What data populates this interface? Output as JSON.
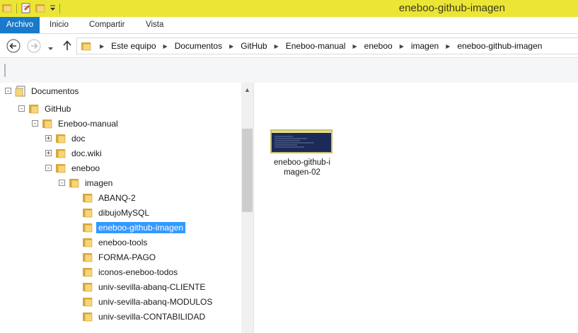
{
  "window": {
    "title": "eneboo-github-imagen"
  },
  "ribbon": {
    "tabs": [
      "Archivo",
      "Inicio",
      "Compartir",
      "Vista"
    ]
  },
  "address": {
    "crumbs": [
      "Este equipo",
      "Documentos",
      "GitHub",
      "Eneboo-manual",
      "eneboo",
      "imagen",
      "eneboo-github-imagen"
    ]
  },
  "tree": [
    {
      "label": "Documentos",
      "expander": "−",
      "icon": "documents-library-icon"
    },
    {
      "label": "GitHub",
      "expander": "−",
      "icon": "folder-icon"
    },
    {
      "label": "Eneboo-manual",
      "expander": "−",
      "icon": "folder-icon"
    },
    {
      "label": "doc",
      "expander": "+",
      "icon": "folder-icon"
    },
    {
      "label": "doc.wiki",
      "expander": "+",
      "icon": "folder-icon"
    },
    {
      "label": "eneboo",
      "expander": "−",
      "icon": "folder-icon"
    },
    {
      "label": "imagen",
      "expander": "−",
      "icon": "folder-icon"
    },
    {
      "label": "ABANQ-2",
      "expander": "",
      "icon": "folder-icon"
    },
    {
      "label": "dibujoMySQL",
      "expander": "",
      "icon": "folder-icon"
    },
    {
      "label": "eneboo-github-imagen",
      "expander": "",
      "icon": "folder-icon",
      "selected": true
    },
    {
      "label": "eneboo-tools",
      "expander": "",
      "icon": "folder-icon"
    },
    {
      "label": "FORMA-PAGO",
      "expander": "",
      "icon": "folder-icon"
    },
    {
      "label": "iconos-eneboo-todos",
      "expander": "",
      "icon": "folder-icon"
    },
    {
      "label": "univ-sevilla-abanq-CLIENTE",
      "expander": "",
      "icon": "folder-icon"
    },
    {
      "label": "univ-sevilla-abanq-MODULOS",
      "expander": "",
      "icon": "folder-icon"
    },
    {
      "label": "univ-sevilla-CONTABILIDAD",
      "expander": "",
      "icon": "folder-icon"
    }
  ],
  "files": [
    {
      "name": "eneboo-github-i\nmagen-02",
      "line1": "eneboo-github-i",
      "line2": "magen-02"
    }
  ],
  "colors": {
    "titlebar": "#ebe536",
    "file_tab": "#1979ca",
    "selection": "#3399ff"
  }
}
